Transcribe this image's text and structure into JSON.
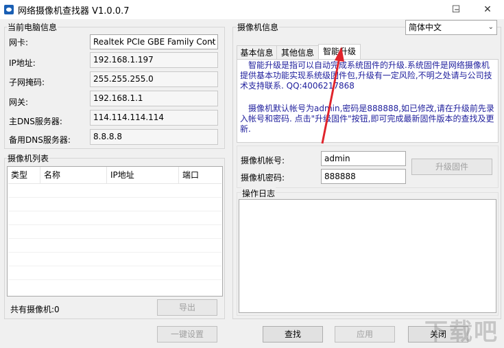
{
  "window": {
    "title": "网络摄像机查找器 V1.0.0.7",
    "minimize": "–",
    "maximize": "☐",
    "close": "✕"
  },
  "pc_info": {
    "group_title": "当前电脑信息",
    "nic_label": "网卡:",
    "nic_value": "Realtek PCIe GBE Family Cont",
    "ip_label": "IP地址:",
    "ip_value": "192.168.1.197",
    "mask_label": "子网掩码:",
    "mask_value": "255.255.255.0",
    "gateway_label": "网关:",
    "gateway_value": "192.168.1.1",
    "dns1_label": "主DNS服务器:",
    "dns1_value": "114.114.114.114",
    "dns2_label": "备用DNS服务器:",
    "dns2_value": "8.8.8.8"
  },
  "camera_list": {
    "group_title": "摄像机列表",
    "columns": [
      "类型",
      "名称",
      "IP地址",
      "端口"
    ],
    "total_label": "共有摄像机:0",
    "export_button": "导出"
  },
  "camera_info": {
    "group_title": "摄像机信息",
    "language": "简体中文",
    "tabs": [
      "基本信息",
      "其他信息",
      "智能升级"
    ],
    "active_tab": "智能升级",
    "upgrade_text": "智能升级是指可以自动完成系统固件的升级.系统固件是网络摄像机提供基本功能实现系统级固件包,升级有一定风险,不明之处请与公司技术支持联系. QQ:4006217868",
    "account_note": "摄像机默认帐号为admin,密码是888888,如已修改,请在升级前先录入帐号和密码. 点击\"升级固件\"按钮,即可完成最新固件版本的查找及更新.",
    "account_label": "摄像机帐号:",
    "account_value": "admin",
    "password_label": "摄像机密码:",
    "password_value": "888888",
    "upgrade_button": "升级固件",
    "log_title": "操作日志"
  },
  "bottom": {
    "oneclick_button": "一键设置",
    "search_button": "查找",
    "apply_button": "应用",
    "close_button": "关闭"
  },
  "watermark": "下载吧"
}
